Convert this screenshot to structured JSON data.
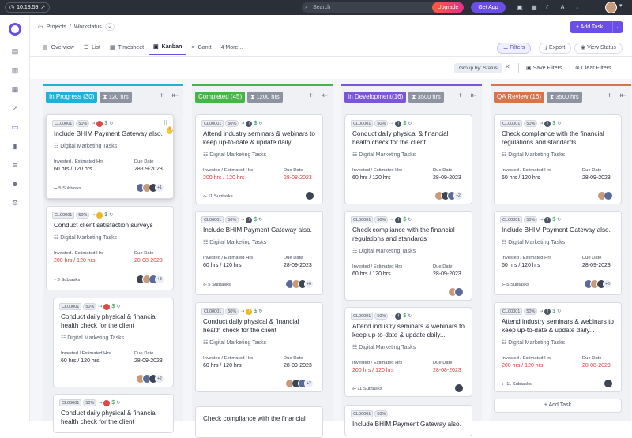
{
  "topbar": {
    "time": "10:18:59",
    "search_placeholder": "Search",
    "upgrade_label": "Upgrade",
    "get_app_label": "Get App"
  },
  "breadcrumb": {
    "root": "Projects",
    "separator": "/",
    "current": "Workstatus"
  },
  "add_task_label": "+ Add Task",
  "tabs": [
    {
      "label": "Overview",
      "icon": "overview-icon"
    },
    {
      "label": "List",
      "icon": "list-icon"
    },
    {
      "label": "Timesheet",
      "icon": "timesheet-icon"
    },
    {
      "label": "Kanban",
      "icon": "kanban-icon",
      "active": true
    },
    {
      "label": "Gantt",
      "icon": "gantt-icon"
    },
    {
      "label": "4 More...",
      "icon": ""
    }
  ],
  "toolbar": {
    "filters": "Filters",
    "export": "Export",
    "view_status": "View Status"
  },
  "filterbar": {
    "group_by": "Group by:",
    "group_value": "Status",
    "save_filters": "Save Filters",
    "clear_filters": "Clear Filters"
  },
  "colors": {
    "accent": "#6b4ee6",
    "in_progress": "#1eb3d6",
    "completed": "#45b548",
    "in_development": "#7a56d8",
    "qa_review": "#d9734a"
  },
  "columns": [
    {
      "status": "In Progress (30)",
      "hours": "120 hrs",
      "color": "#1eb3d6",
      "cards": [
        {
          "id": "CL00001",
          "pct": "50%",
          "title": "Include BHIM Payment Gateway also.",
          "category": "Digital Marketing Tasks",
          "inv_label": "Invested / Estimated Hrs",
          "inv": "60 hrs / 120 hrs",
          "due_label": "Due Date",
          "due": "28-09-2023",
          "subtasks": "5 Subtasks",
          "more": "+1"
        },
        {
          "id": "CL00001",
          "pct": "50%",
          "title": "Conduct client satisfaction surveys",
          "category": "Digital Marketing Tasks",
          "inv_label": "Invested / Estimated Hrs",
          "inv": "200 hrs / 120 hrs",
          "due_label": "Due Date",
          "due": "28-08-2023",
          "subtasks": "3 Subtasks",
          "more": "+3"
        },
        {
          "id": "CL00001",
          "pct": "50%",
          "title": "Conduct daily physical & financial health check for the client",
          "category": "Digital Marketing Tasks",
          "inv_label": "Invested / Estimated Hrs",
          "inv": "60 hrs / 120 hrs",
          "due_label": "Due Date",
          "due": "28-09-2023",
          "more": "+2"
        },
        {
          "id": "CL00001",
          "pct": "50%",
          "title": "Conduct daily physical & financial health check for the client"
        }
      ]
    },
    {
      "status": "Completed (45)",
      "hours": "1200 hrs",
      "color": "#45b548",
      "cards": [
        {
          "id": "CL00001",
          "pct": "50%",
          "title": "Attend industry seminars & webinars to keep up-to-date & update daily...",
          "category": "Digital Marketing Tasks",
          "inv_label": "Invested / Estimated Hrs",
          "inv": "200 hrs / 120 hrs",
          "due_label": "Due Date",
          "due": "28-08-2023",
          "subtasks": "11 Subtasks"
        },
        {
          "id": "CL00001",
          "pct": "50%",
          "title": "Include BHIM Payment Gateway also.",
          "category": "Digital Marketing Tasks",
          "inv_label": "Invested / Estimated Hrs",
          "inv": "60 hrs / 120 hrs",
          "due_label": "Due Date",
          "due": "28-09-2023",
          "subtasks": "5 Subtasks",
          "more": "+6"
        },
        {
          "id": "CL00001",
          "pct": "50%",
          "title": "Conduct daily physical & financial health check for the client",
          "category": "Digital Marketing Tasks",
          "inv_label": "Invested / Estimated Hrs",
          "inv": "60 hrs / 120 hrs",
          "due_label": "Due Date",
          "due": "28-09-2023",
          "more": "+2"
        },
        {
          "title": "Check compliance with the financial"
        }
      ]
    },
    {
      "status": "In Development(16)",
      "hours": "3500 hrs",
      "color": "#7a56d8",
      "cards": [
        {
          "id": "CL00001",
          "pct": "50%",
          "title": "Conduct daily physical & financial health check for the client",
          "category": "Digital Marketing Tasks",
          "inv_label": "Invested / Estimated Hrs",
          "inv": "60 hrs / 120 hrs",
          "due_label": "Due Date",
          "due": "28-09-2023",
          "more": "+2"
        },
        {
          "id": "CL00001",
          "pct": "50%",
          "title": "Check compliance with the financial regulations and standards",
          "category": "Digital Marketing Tasks",
          "inv_label": "Invested / Estimated Hrs",
          "inv": "60 hrs / 120 hrs",
          "due_label": "Due Date",
          "due": "28-09-2023"
        },
        {
          "id": "CL00001",
          "pct": "50%",
          "title": "Attend industry seminars & webinars to keep up-to-date & update daily...",
          "category": "Digital Marketing Tasks",
          "inv_label": "Invested / Estimated Hrs",
          "inv": "200 hrs / 120 hrs",
          "due_label": "Due Date",
          "due": "28-08-2023",
          "subtasks": "11 Subtasks"
        },
        {
          "id": "CL00001",
          "pct": "50%",
          "title": "Include BHIM Payment Gateway also."
        }
      ]
    },
    {
      "status": "QA Review (16)",
      "hours": "3500 hrs",
      "color": "#d9734a",
      "cards": [
        {
          "id": "CL00001",
          "pct": "50%",
          "title": "Check compliance with the financial regulations and standards",
          "category": "Digital Marketing Tasks",
          "inv_label": "Invested / Estimated Hrs",
          "inv": "60 hrs / 120 hrs",
          "due_label": "Due Date",
          "due": "28-09-2023"
        },
        {
          "id": "CL00001",
          "pct": "50%",
          "title": "Include BHIM Payment Gateway also.",
          "category": "Digital Marketing Tasks",
          "inv_label": "Invested / Estimated Hrs",
          "inv": "60 hrs / 120 hrs",
          "due_label": "Due Date",
          "due": "28-09-2023",
          "subtasks": "5 Subtasks",
          "more": "+6"
        },
        {
          "id": "CL00001",
          "pct": "50%",
          "title": "Attend industry seminars & webinars to keep up-to-date & update daily...",
          "category": "Digital Marketing Tasks",
          "inv_label": "Invested / Estimated Hrs",
          "inv": "200 hrs / 120 hrs",
          "due_label": "Due Date",
          "due": "28-08-2023",
          "subtasks": "11 Subtasks"
        }
      ],
      "add_task": "+ Add Task"
    }
  ]
}
